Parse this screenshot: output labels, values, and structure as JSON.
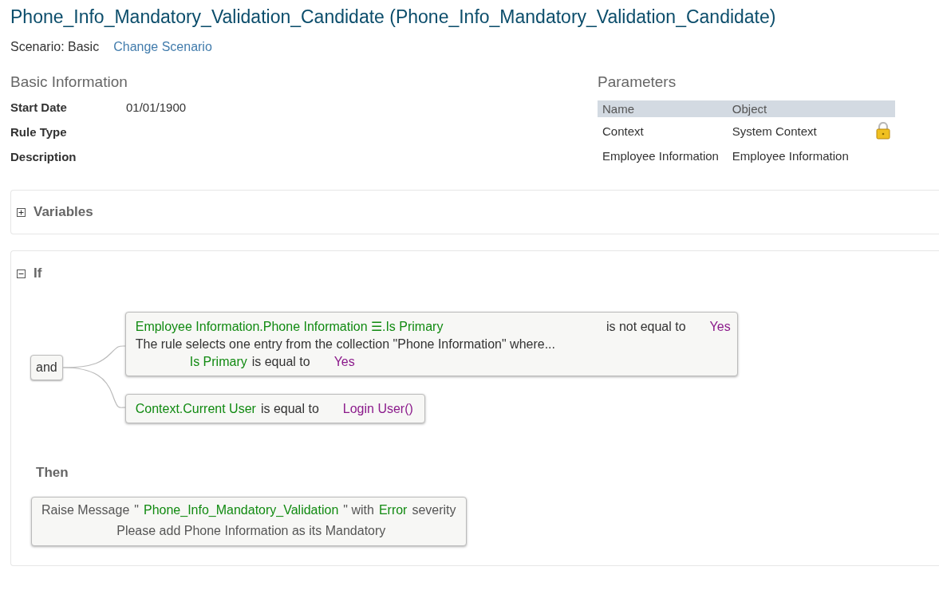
{
  "title": "Phone_Info_Mandatory_Validation_Candidate (Phone_Info_Mandatory_Validation_Candidate)",
  "scenario": {
    "label": "Scenario: Basic",
    "link": "Change Scenario"
  },
  "basic_information": {
    "heading": "Basic Information",
    "fields": [
      {
        "label": "Start Date",
        "value": "01/01/1900"
      },
      {
        "label": "Rule Type"
      },
      {
        "label": "Description"
      }
    ]
  },
  "parameters": {
    "heading": "Parameters",
    "columns": [
      "Name",
      "Object"
    ],
    "rows": [
      {
        "name": "Context",
        "object": "System Context",
        "locked": true
      },
      {
        "name": "Employee Information",
        "object": "Employee Information",
        "locked": false
      }
    ]
  },
  "variables": {
    "title": "Variables",
    "expanded": false
  },
  "if_block": {
    "title": "If",
    "expanded": true,
    "connective": "and",
    "conditions": [
      {
        "tokens": [
          {
            "kind": "field",
            "text": "Employee Information.Phone Information ☰.Is Primary"
          },
          {
            "kind": "operator",
            "text": "is not equal to"
          },
          {
            "kind": "value",
            "text": "Yes"
          }
        ],
        "note": "The rule selects one entry from the collection \"Phone Information\" where...",
        "sub_tokens": [
          {
            "kind": "field",
            "text": "Is Primary"
          },
          {
            "kind": "operator",
            "text": "is equal to"
          },
          {
            "kind": "value",
            "text": "Yes"
          }
        ]
      },
      {
        "tokens": [
          {
            "kind": "field",
            "text": "Context.Current User"
          },
          {
            "kind": "operator",
            "text": "is equal to"
          },
          {
            "kind": "value",
            "text": "Login User()"
          }
        ]
      }
    ]
  },
  "then_block": {
    "title": "Then",
    "actions": [
      {
        "tokens": [
          {
            "kind": "operator",
            "text": "Raise Message"
          },
          {
            "kind": "operator",
            "text": "\""
          },
          {
            "kind": "field",
            "text": "Phone_Info_Mandatory_Validation"
          },
          {
            "kind": "operator",
            "text": "\" with"
          },
          {
            "kind": "field",
            "text": "Error"
          },
          {
            "kind": "operator",
            "text": "severity"
          }
        ],
        "message": "Please add Phone Information as its Mandatory"
      }
    ]
  }
}
